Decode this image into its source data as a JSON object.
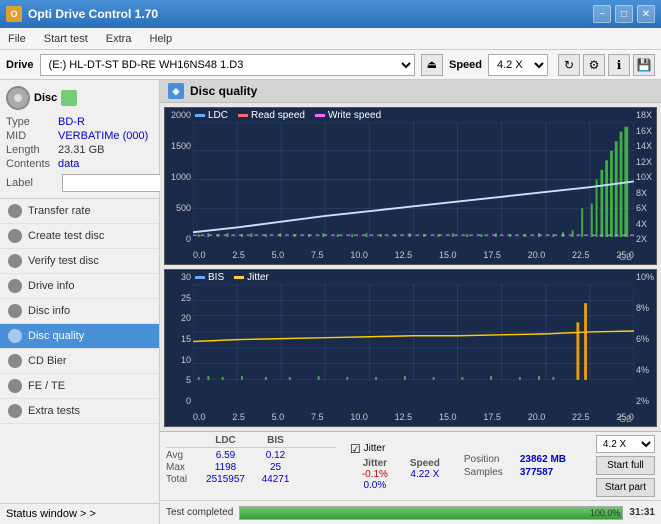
{
  "app": {
    "title": "Opti Drive Control 1.70",
    "icon": "O"
  },
  "title_controls": {
    "minimize": "−",
    "maximize": "□",
    "close": "✕"
  },
  "menu": {
    "items": [
      "File",
      "Start test",
      "Extra",
      "Help"
    ]
  },
  "drive_bar": {
    "label": "Drive",
    "drive_value": "(E:)  HL-DT-ST BD-RE  WH16NS48 1.D3",
    "speed_label": "Speed",
    "speed_value": "4.2 X",
    "eject_symbol": "⏏"
  },
  "disc_panel": {
    "header": "Disc",
    "rows": [
      {
        "key": "Type",
        "val": "BD-R",
        "blue": true
      },
      {
        "key": "MID",
        "val": "VERBATIMe (000)",
        "blue": true
      },
      {
        "key": "Length",
        "val": "23.31 GB",
        "blue": false
      },
      {
        "key": "Contents",
        "val": "data",
        "blue": true
      }
    ],
    "label_key": "Label",
    "label_placeholder": ""
  },
  "nav": {
    "items": [
      {
        "id": "transfer-rate",
        "label": "Transfer rate",
        "active": false
      },
      {
        "id": "create-test-disc",
        "label": "Create test disc",
        "active": false
      },
      {
        "id": "verify-test-disc",
        "label": "Verify test disc",
        "active": false
      },
      {
        "id": "drive-info",
        "label": "Drive info",
        "active": false
      },
      {
        "id": "disc-info",
        "label": "Disc info",
        "active": false
      },
      {
        "id": "disc-quality",
        "label": "Disc quality",
        "active": true
      },
      {
        "id": "cd-bier",
        "label": "CD Bier",
        "active": false
      },
      {
        "id": "fe-te",
        "label": "FE / TE",
        "active": false
      },
      {
        "id": "extra-tests",
        "label": "Extra tests",
        "active": false
      }
    ]
  },
  "status_window": {
    "label": "Status window > >"
  },
  "disc_quality": {
    "title": "Disc quality",
    "legend": {
      "ldc_label": "LDC",
      "read_label": "Read speed",
      "write_label": "Write speed"
    }
  },
  "chart_top": {
    "y_left": [
      "2000",
      "1500",
      "1000",
      "500",
      "0"
    ],
    "y_right": [
      "18X",
      "16X",
      "14X",
      "12X",
      "10X",
      "8X",
      "6X",
      "4X",
      "2X"
    ],
    "x_labels": [
      "0.0",
      "2.5",
      "5.0",
      "7.5",
      "10.0",
      "12.5",
      "15.0",
      "17.5",
      "20.0",
      "22.5",
      "25.0"
    ],
    "x_unit": "GB"
  },
  "chart_bottom": {
    "title_left": "BIS",
    "title_right": "Jitter",
    "y_left": [
      "30",
      "25",
      "20",
      "15",
      "10",
      "5",
      "0"
    ],
    "y_right": [
      "10%",
      "8%",
      "6%",
      "4%",
      "2%"
    ],
    "x_labels": [
      "0.0",
      "2.5",
      "5.0",
      "7.5",
      "10.0",
      "12.5",
      "15.0",
      "17.5",
      "20.0",
      "22.5",
      "25.0"
    ],
    "x_unit": "GB"
  },
  "stats": {
    "columns": [
      "",
      "LDC",
      "BIS",
      "",
      "Jitter",
      "Speed",
      ""
    ],
    "avg_row": {
      "label": "Avg",
      "ldc": "6.59",
      "bis": "0.12",
      "jitter": "-0.1%",
      "speed": "4.22 X"
    },
    "max_row": {
      "label": "Max",
      "ldc": "1198",
      "bis": "25",
      "jitter": "0.0%"
    },
    "total_row": {
      "label": "Total",
      "ldc": "2515957",
      "bis": "44271"
    },
    "position_label": "Position",
    "position_val": "23862 MB",
    "samples_label": "Samples",
    "samples_val": "377587",
    "speed_select": "4.2 X",
    "jitter_checked": true,
    "jitter_label": "Jitter"
  },
  "buttons": {
    "start_full": "Start full",
    "start_part": "Start part"
  },
  "progress": {
    "label": "Test completed",
    "percent": 100,
    "percent_label": "100.0%",
    "time": "31:31"
  }
}
